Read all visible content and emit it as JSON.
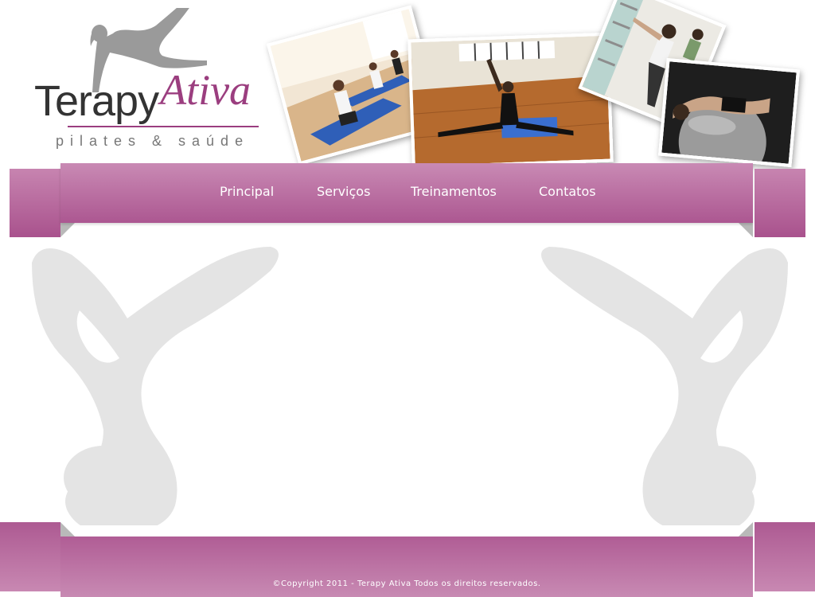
{
  "logo": {
    "name_main": "Terapy",
    "name_accent": "Ativa",
    "tagline": "pilates & saúde",
    "icon": "pilates-figure-icon"
  },
  "nav": {
    "items": [
      {
        "label": "Principal"
      },
      {
        "label": "Serviços"
      },
      {
        "label": "Treinamentos"
      },
      {
        "label": "Contatos"
      }
    ]
  },
  "footer": {
    "copyright_symbol": "©",
    "copyright_text": "Copyright  2011 - Terapy Ativa Todos os direitos reservados."
  },
  "colors": {
    "brand": "#9b3e7f",
    "band_light": "#c98ab4",
    "band_dark": "#ac5791",
    "silhouette": "#e4e4e4"
  }
}
